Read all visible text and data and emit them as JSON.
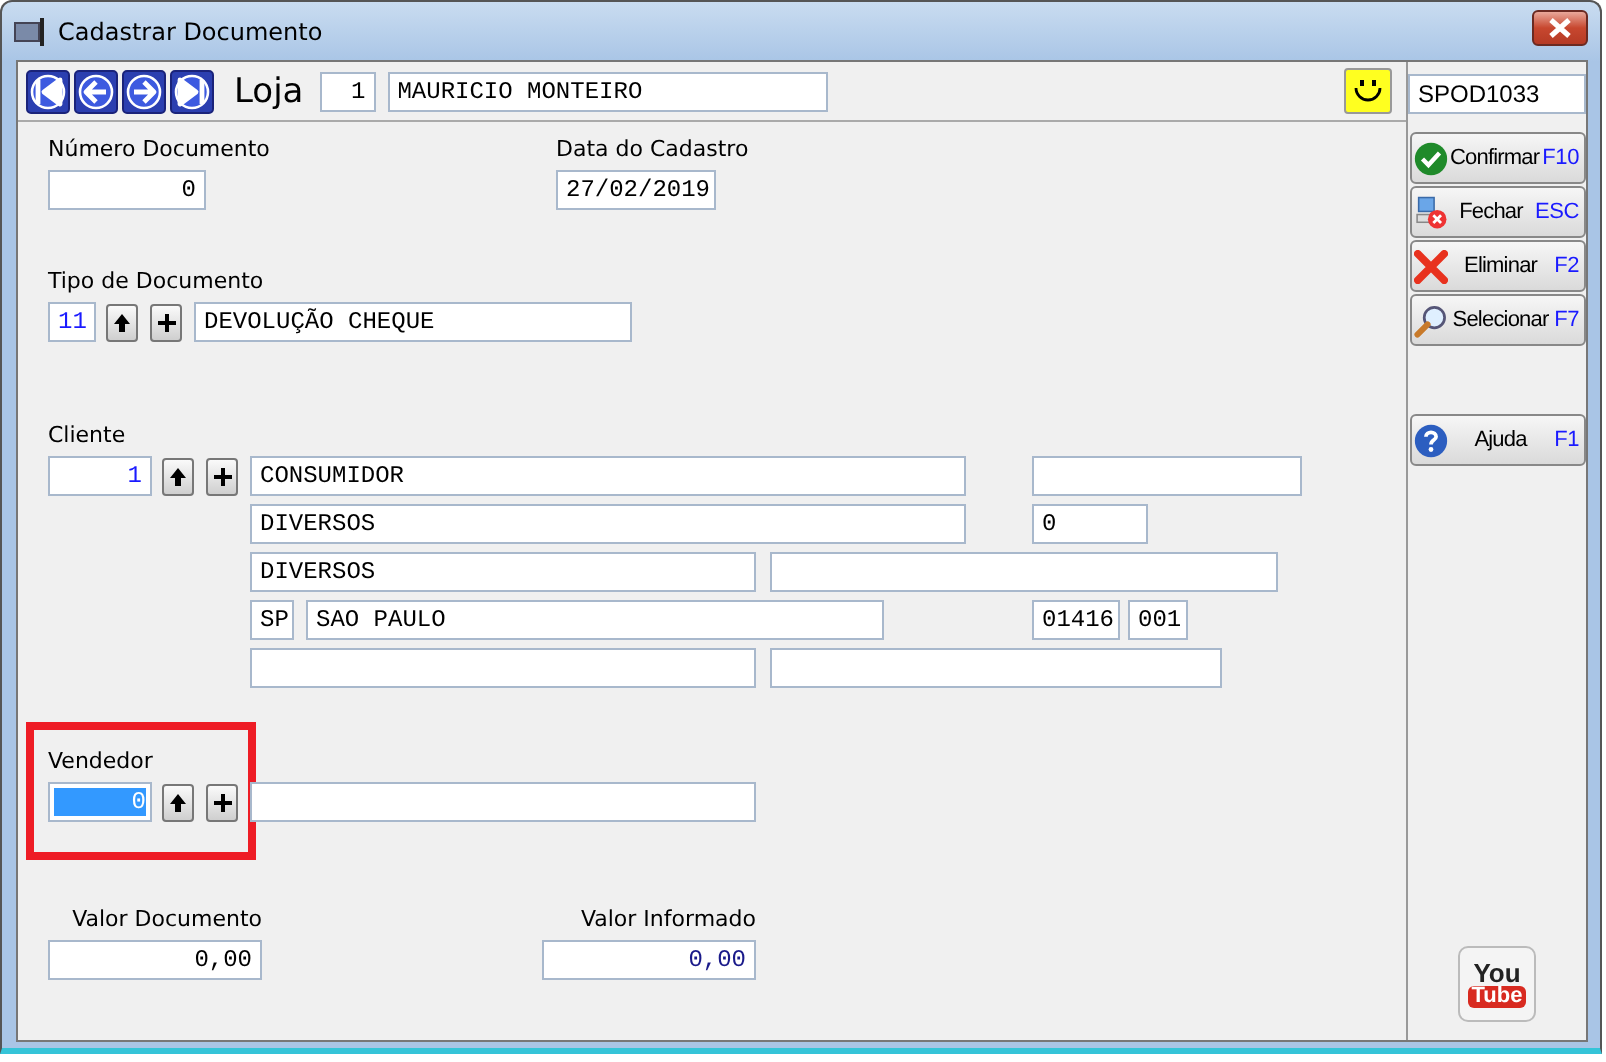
{
  "window": {
    "title": "Cadastrar Documento"
  },
  "toolbar": {
    "store_label": "Loja",
    "store_code": "1",
    "store_name": "MAURICIO MONTEIRO"
  },
  "program_code": "SPOD1033",
  "numero_documento": {
    "label": "Número Documento",
    "value": "0"
  },
  "data_cadastro": {
    "label": "Data do Cadastro",
    "value": "27/02/2019"
  },
  "tipo_documento": {
    "label": "Tipo de Documento",
    "code": "11",
    "description": "DEVOLUÇÃO CHEQUE"
  },
  "cliente": {
    "label": "Cliente",
    "code": "1",
    "name": "CONSUMIDOR",
    "line_2": "DIVERSOS",
    "number": "0",
    "line_3": "DIVERSOS",
    "state": "SP",
    "city": "SAO PAULO",
    "zip": "01416",
    "zip_suffix": "001"
  },
  "vendedor": {
    "label": "Vendedor",
    "code": "0",
    "selected": true,
    "highlighted": true
  },
  "valor_documento": {
    "label": "Valor Documento",
    "value": "0,00"
  },
  "valor_informado": {
    "label": "Valor Informado",
    "value": "0,00"
  },
  "actions": [
    {
      "kind": "confirm",
      "label": "Confirmar",
      "shortcut": "F10"
    },
    {
      "kind": "close",
      "label": "Fechar",
      "shortcut": "ESC"
    },
    {
      "kind": "delete",
      "label": "Eliminar",
      "shortcut": "F2"
    },
    {
      "kind": "select",
      "label": "Selecionar",
      "shortcut": "F7"
    }
  ],
  "help": {
    "kind": "help",
    "label": "Ajuda",
    "shortcut": "F1"
  },
  "logo": {
    "top": "You",
    "bottom": "Tube"
  }
}
